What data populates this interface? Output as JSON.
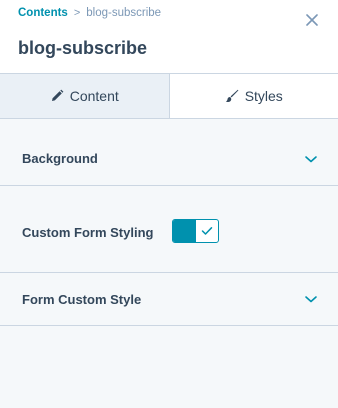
{
  "breadcrumb": {
    "parent": "Contents",
    "separator": ">",
    "current": "blog-subscribe"
  },
  "header": {
    "title": "blog-subscribe"
  },
  "tabs": [
    {
      "label": "Content",
      "icon": "pencil-icon",
      "active": false
    },
    {
      "label": "Styles",
      "icon": "brush-icon",
      "active": true
    }
  ],
  "sections": {
    "background": {
      "label": "Background"
    },
    "custom_form_styling": {
      "label": "Custom Form Styling",
      "enabled": true
    },
    "form_custom_style": {
      "label": "Form Custom Style"
    }
  },
  "colors": {
    "accent": "#0091ae",
    "text": "#33475b",
    "muted": "#7c98b6",
    "border": "#cbd6e2",
    "panel_bg": "#f5f8fa"
  }
}
